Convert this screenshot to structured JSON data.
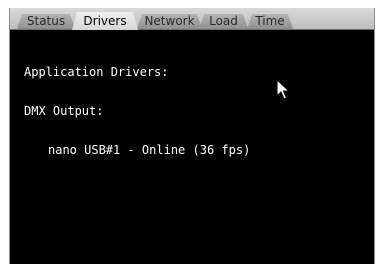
{
  "tabs": [
    {
      "label": "Status",
      "active": false
    },
    {
      "label": "Drivers",
      "active": true
    },
    {
      "label": "Network",
      "active": false
    },
    {
      "label": "Load",
      "active": false
    },
    {
      "label": "Time",
      "active": false
    }
  ],
  "console": {
    "line1": "Application Drivers:",
    "line2": "DMX Output:",
    "line3": "nano USB#1 - Online (36 fps)"
  },
  "colors": {
    "background": "#000000",
    "text": "#ffffff",
    "tab_active": "#e6e6e6",
    "tab_inactive": "#a6a6a6"
  },
  "icons": {
    "cursor": "mouse-pointer-icon"
  }
}
